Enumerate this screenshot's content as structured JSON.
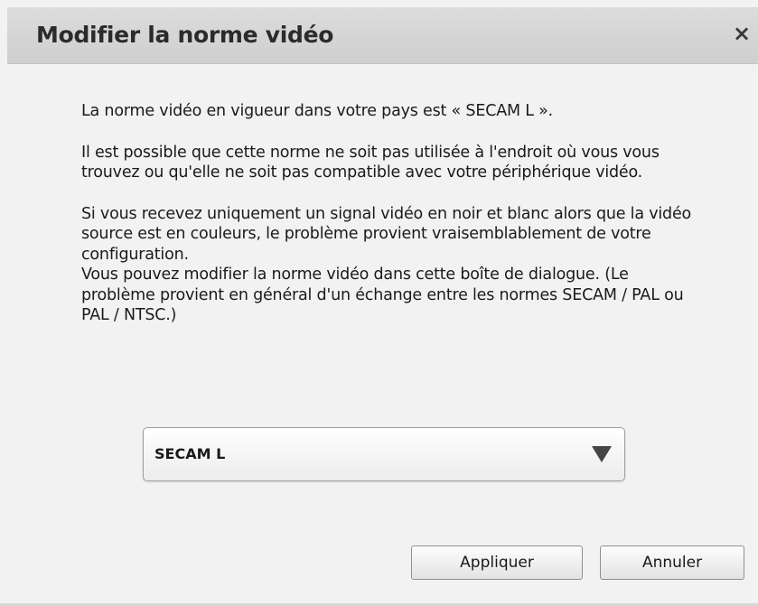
{
  "dialog": {
    "title": "Modifier la norme vidéo",
    "close_label": "×"
  },
  "message": {
    "para1": "La norme vidéo en vigueur dans votre pays est « SECAM L ».",
    "para2": "Il est possible que cette norme ne soit pas utilisée à l'endroit où vous vous trouvez ou qu'elle ne soit pas compatible avec votre périphérique vidéo.",
    "para3": "Si vous recevez uniquement un signal vidéo en noir et blanc alors que la vidéo source est en couleurs, le problème provient vraisemblablement de votre configuration.",
    "para4": "Vous pouvez modifier la norme vidéo dans cette boîte de dialogue. (Le problème provient en général d'un échange entre les normes SECAM / PAL ou PAL / NTSC.)"
  },
  "norm_select": {
    "selected": "SECAM L",
    "icon": "dropdown-arrow-icon"
  },
  "buttons": {
    "apply": "Appliquer",
    "cancel": "Annuler"
  },
  "colors": {
    "titlebar": "#d6d6d6",
    "background": "#f2f2f2",
    "text": "#1a1a1a"
  }
}
